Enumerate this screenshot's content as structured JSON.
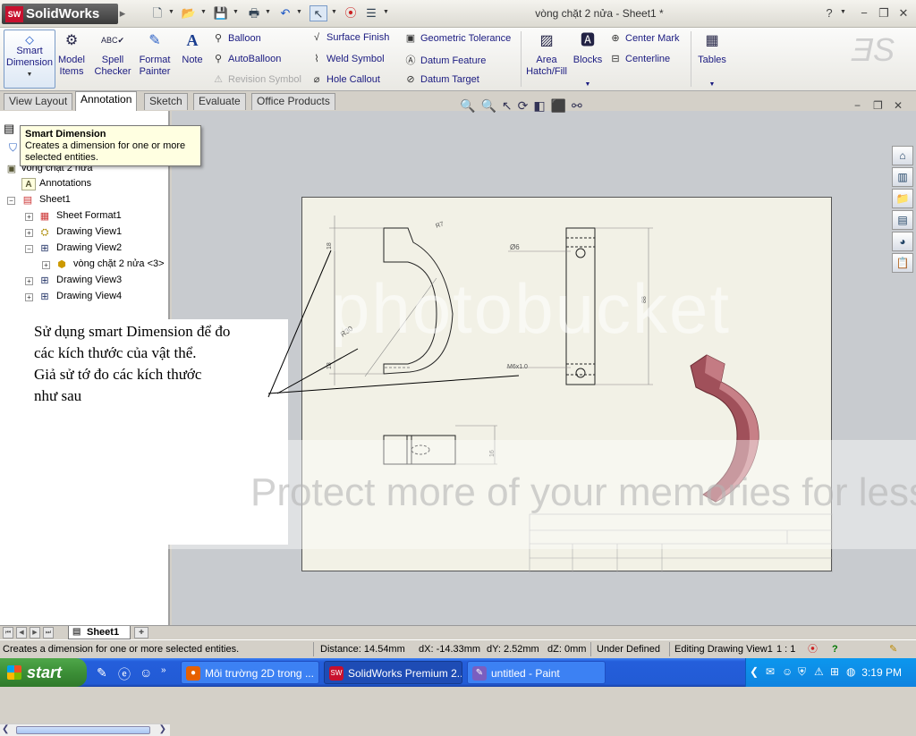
{
  "app": {
    "name": "SolidWorks",
    "logo_badge": "SW",
    "document_title": "vòng chặt 2 nửa - Sheet1 *"
  },
  "titlebar": {
    "help": "?",
    "minimize": "−",
    "restore": "❐",
    "close": "✕"
  },
  "ribbon": {
    "smart_dimension": "Smart Dimension",
    "model_items": "Model Items",
    "spell_checker": "Spell Checker",
    "format_painter": "Format Painter",
    "note": "Note",
    "balloon": "Balloon",
    "autoballoon": "AutoBalloon",
    "revision_symbol": "Revision Symbol",
    "surface_finish": "Surface Finish",
    "weld_symbol": "Weld Symbol",
    "hole_callout": "Hole Callout",
    "geometric_tolerance": "Geometric Tolerance",
    "datum_feature": "Datum Feature",
    "datum_target": "Datum Target",
    "area_hatch": "Area Hatch/Fill",
    "blocks": "Blocks",
    "center_mark": "Center Mark",
    "centerline": "Centerline",
    "tables": "Tables"
  },
  "tabs": [
    "View Layout",
    "Annotation",
    "Sketch",
    "Evaluate",
    "Office Products"
  ],
  "active_tab": "Annotation",
  "tooltip": {
    "title": "Smart Dimension",
    "body": "Creates a dimension for one or more selected entities."
  },
  "tree": {
    "root": "vòng chặt 2 nửa",
    "annotations": "Annotations",
    "sheet": "Sheet1",
    "sheet_format": "Sheet Format1",
    "view1": "Drawing View1",
    "view2": "Drawing View2",
    "part": "vòng chặt 2 nửa <3>",
    "view3": "Drawing View3",
    "view4": "Drawing View4"
  },
  "annotation_text": {
    "line1": "Sử dụng smart Dimension để đo",
    "line2": "các kích thước của vật thể.",
    "line3": "Giả sử tớ đo các kích thước",
    "line4": "như sau"
  },
  "drawing": {
    "dim_r": "R7",
    "dim_r30": "R30",
    "dim_phi": "Ø6",
    "dim_thread": "M6x1.0",
    "dim_88": "88",
    "dim_18a": "18",
    "dim_18b": "18",
    "dim_16": "16"
  },
  "watermark": {
    "brand": "photobucket",
    "slogan": "Protect more of your memories for less!"
  },
  "sheet_tab": "Sheet1",
  "status": {
    "message": "Creates a dimension for one or more selected entities.",
    "distance": "Distance: 14.54mm",
    "dx": "dX: -14.33mm",
    "dy": "dY: 2.52mm",
    "dz": "dZ: 0mm",
    "definition": "Under Defined",
    "mode": "Editing Drawing View1",
    "scale": "1 : 1"
  },
  "taskbar": {
    "start": "start",
    "tasks": [
      "Môi trường 2D trong ...",
      "SolidWorks Premium 2...",
      "untitled - Paint"
    ],
    "clock": "3:19 PM"
  },
  "colors": {
    "part_fill": "#a0505a",
    "taskbar_blue": "#245edb",
    "start_green": "#3c8f37",
    "sheet_bg": "#f2f1e6"
  }
}
